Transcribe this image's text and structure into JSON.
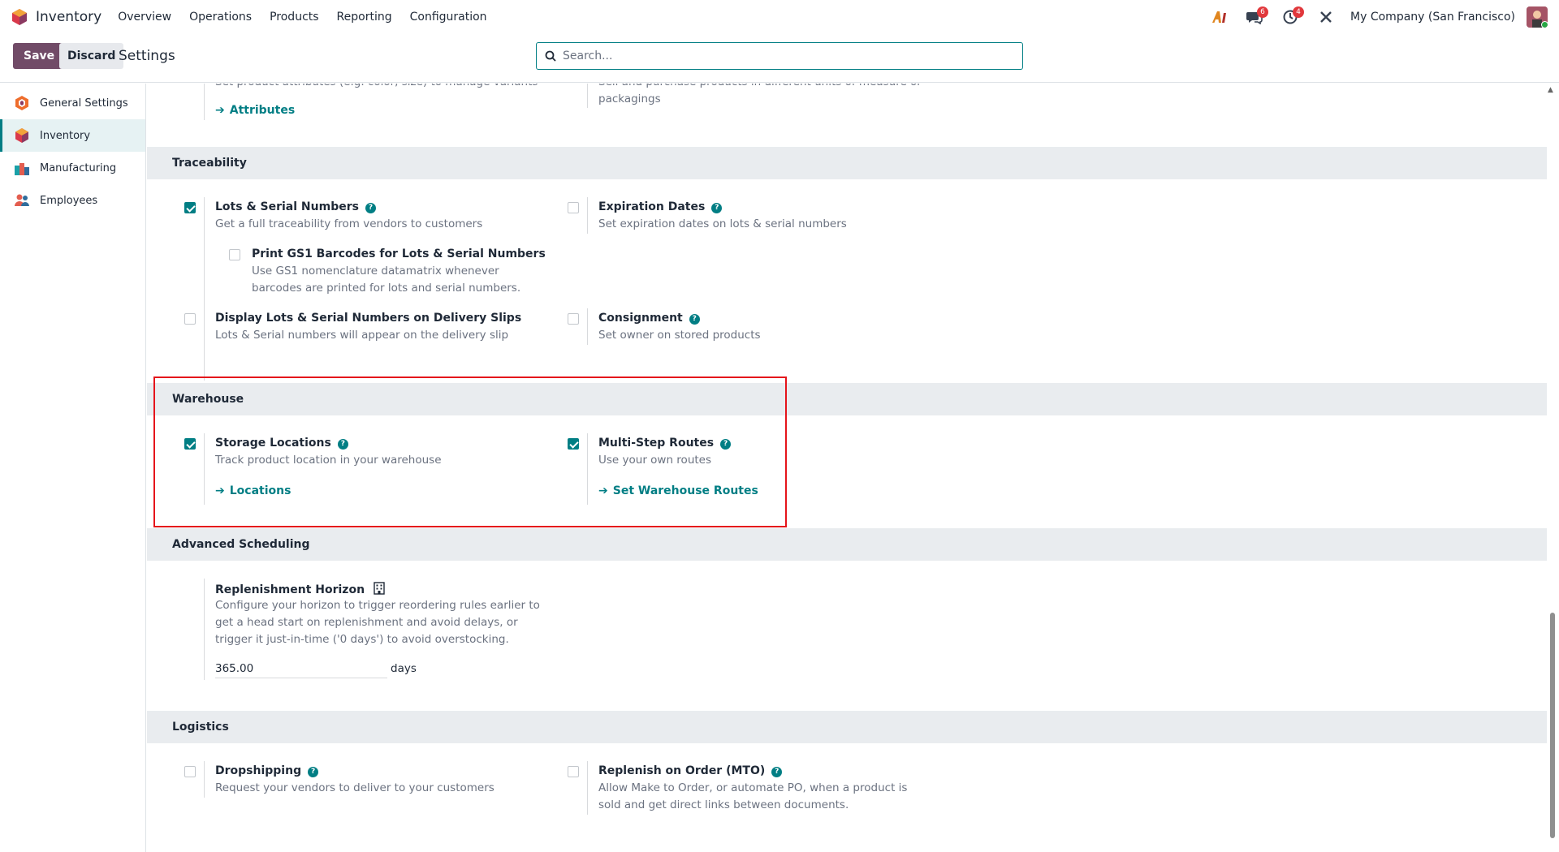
{
  "navbar": {
    "app_name": "Inventory",
    "menu": [
      "Overview",
      "Operations",
      "Products",
      "Reporting",
      "Configuration"
    ],
    "discuss_badge": "6",
    "activity_badge": "4",
    "company": "My Company (San Francisco)"
  },
  "control": {
    "save_label": "Save",
    "discard_label": "Discard",
    "breadcrumb": "Settings",
    "search_placeholder": "Search..."
  },
  "sidebar": {
    "items": [
      {
        "label": "General Settings",
        "icon": "odoo-icon"
      },
      {
        "label": "Inventory",
        "icon": "inventory-icon",
        "active": true
      },
      {
        "label": "Manufacturing",
        "icon": "manufacturing-icon"
      },
      {
        "label": "Employees",
        "icon": "employees-icon"
      }
    ]
  },
  "top_partial": {
    "variants_desc_partial": "Set product attributes (e.g. color, size) to manage variants",
    "uom_desc_partial": "Sell and purchase products in different units of measure or",
    "uom_desc_line2": "packagings",
    "attributes_link": "Attributes"
  },
  "traceability": {
    "header": "Traceability",
    "lots": {
      "title": "Lots & Serial Numbers",
      "desc": "Get a full traceability from vendors to customers",
      "checked": true
    },
    "gs1": {
      "title": "Print GS1 Barcodes for Lots & Serial Numbers",
      "desc": "Use GS1 nomenclature datamatrix whenever barcodes are printed for lots and serial numbers.",
      "checked": false
    },
    "expiration": {
      "title": "Expiration Dates",
      "desc": "Set expiration dates on lots & serial numbers",
      "checked": false
    },
    "display_lots": {
      "title": "Display Lots & Serial Numbers on Delivery Slips",
      "desc": "Lots & Serial numbers will appear on the delivery slip",
      "checked": false
    },
    "consignment": {
      "title": "Consignment",
      "desc": "Set owner on stored products",
      "checked": false
    }
  },
  "warehouse": {
    "header": "Warehouse",
    "storage": {
      "title": "Storage Locations",
      "desc": "Track product location in your warehouse",
      "link": "Locations",
      "checked": true
    },
    "routes": {
      "title": "Multi-Step Routes",
      "desc": "Use your own routes",
      "link": "Set Warehouse Routes",
      "checked": true
    }
  },
  "advanced": {
    "header": "Advanced Scheduling",
    "horizon": {
      "title": "Replenishment Horizon",
      "desc": "Configure your horizon to trigger reordering rules earlier to get a head start on replenishment and avoid delays, or trigger it just-in-time ('0 days') to avoid overstocking.",
      "value": "365.00",
      "unit": "days"
    }
  },
  "logistics": {
    "header": "Logistics",
    "dropshipping": {
      "title": "Dropshipping",
      "desc": "Request your vendors to deliver to your customers",
      "checked": false
    },
    "mto": {
      "title": "Replenish on Order (MTO)",
      "desc": "Allow Make to Order, or automate PO, when a product is sold and get direct links between documents.",
      "checked": false
    }
  },
  "colors": {
    "primary": "#714b67",
    "accent": "#017e84",
    "highlight": "#e5141b"
  }
}
